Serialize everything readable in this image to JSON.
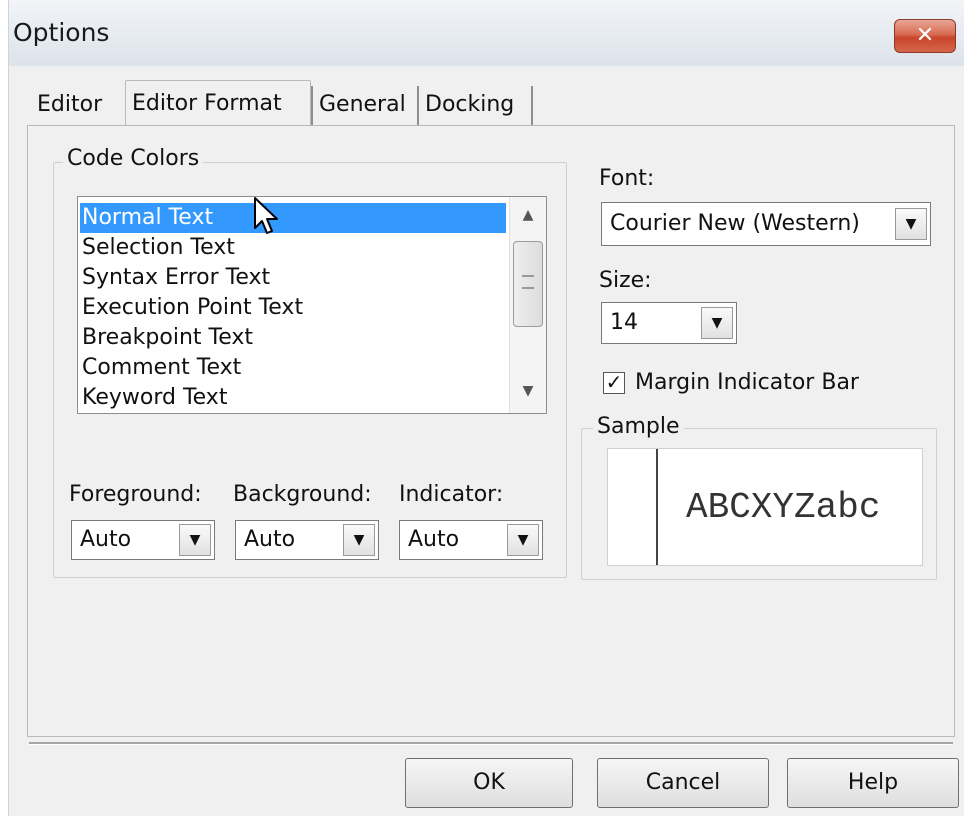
{
  "window": {
    "title": "Options",
    "close_glyph": "x"
  },
  "tabs": [
    {
      "label": "Editor",
      "selected": false
    },
    {
      "label": "Editor Format",
      "selected": true
    },
    {
      "label": "General",
      "selected": false
    },
    {
      "label": "Docking",
      "selected": false
    }
  ],
  "code_colors": {
    "legend": "Code Colors",
    "items": [
      {
        "label": "Normal Text",
        "selected": true
      },
      {
        "label": "Selection Text",
        "selected": false
      },
      {
        "label": "Syntax Error Text",
        "selected": false
      },
      {
        "label": "Execution Point Text",
        "selected": false
      },
      {
        "label": "Breakpoint Text",
        "selected": false
      },
      {
        "label": "Comment Text",
        "selected": false
      },
      {
        "label": "Keyword Text",
        "selected": false
      }
    ],
    "foreground": {
      "label": "Foreground:",
      "value": "Auto"
    },
    "background": {
      "label": "Background:",
      "value": "Auto"
    },
    "indicator": {
      "label": "Indicator:",
      "value": "Auto"
    }
  },
  "font": {
    "label": "Font:",
    "value": "Courier New (Western)"
  },
  "size": {
    "label": "Size:",
    "value": "14"
  },
  "margin_indicator": {
    "label": "Margin Indicator Bar",
    "checked": true
  },
  "sample": {
    "legend": "Sample",
    "text": "ABCXYZabc"
  },
  "buttons": {
    "ok": "OK",
    "cancel": "Cancel",
    "help": "Help"
  },
  "icons": {
    "close": "close-icon",
    "dropdown": "chevron-down-icon",
    "cursor": "mouse-pointer-icon"
  },
  "colors": {
    "selection": "#3399ff",
    "close_button": "#c8452b"
  }
}
